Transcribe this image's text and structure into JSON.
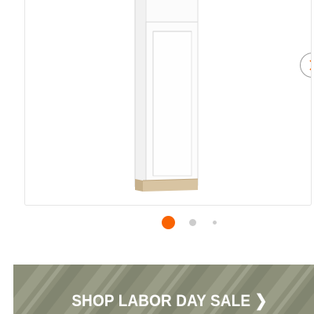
{
  "product_carousel": {
    "next_icon": "chevron-right-icon",
    "accent_color": "#f96302",
    "slide_count": 3,
    "active_slide": 1
  },
  "promo_banner": {
    "label": "SHOP LABOR DAY SALE ❯",
    "background_color": "#8c8f79"
  }
}
